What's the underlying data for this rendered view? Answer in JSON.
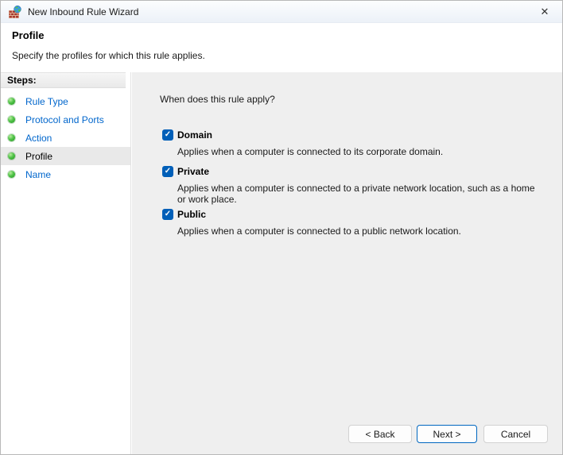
{
  "window": {
    "title": "New Inbound Rule Wizard"
  },
  "glyphs": {
    "close": "✕",
    "check": "✓"
  },
  "header": {
    "title": "Profile",
    "subtitle": "Specify the profiles for which this rule applies."
  },
  "sidebar": {
    "heading": "Steps:",
    "steps": [
      {
        "label": "Rule Type",
        "active": false
      },
      {
        "label": "Protocol and Ports",
        "active": false
      },
      {
        "label": "Action",
        "active": false
      },
      {
        "label": "Profile",
        "active": true
      },
      {
        "label": "Name",
        "active": false
      }
    ]
  },
  "content": {
    "question": "When does this rule apply?",
    "profiles": [
      {
        "label": "Domain",
        "checked": true,
        "description": "Applies when a computer is connected to its corporate domain."
      },
      {
        "label": "Private",
        "checked": true,
        "description": "Applies when a computer is connected to a private network location, such as a home\nor work place."
      },
      {
        "label": "Public",
        "checked": true,
        "description": "Applies when a computer is connected to a public network location."
      }
    ]
  },
  "footer": {
    "back_label": "< Back",
    "next_label": "Next >",
    "cancel_label": "Cancel"
  },
  "colors": {
    "accent": "#005fb8",
    "link": "#0066cc",
    "bullet_green": "#3db53b",
    "panel_bg": "#efefef",
    "next_border": "#0067c0"
  }
}
